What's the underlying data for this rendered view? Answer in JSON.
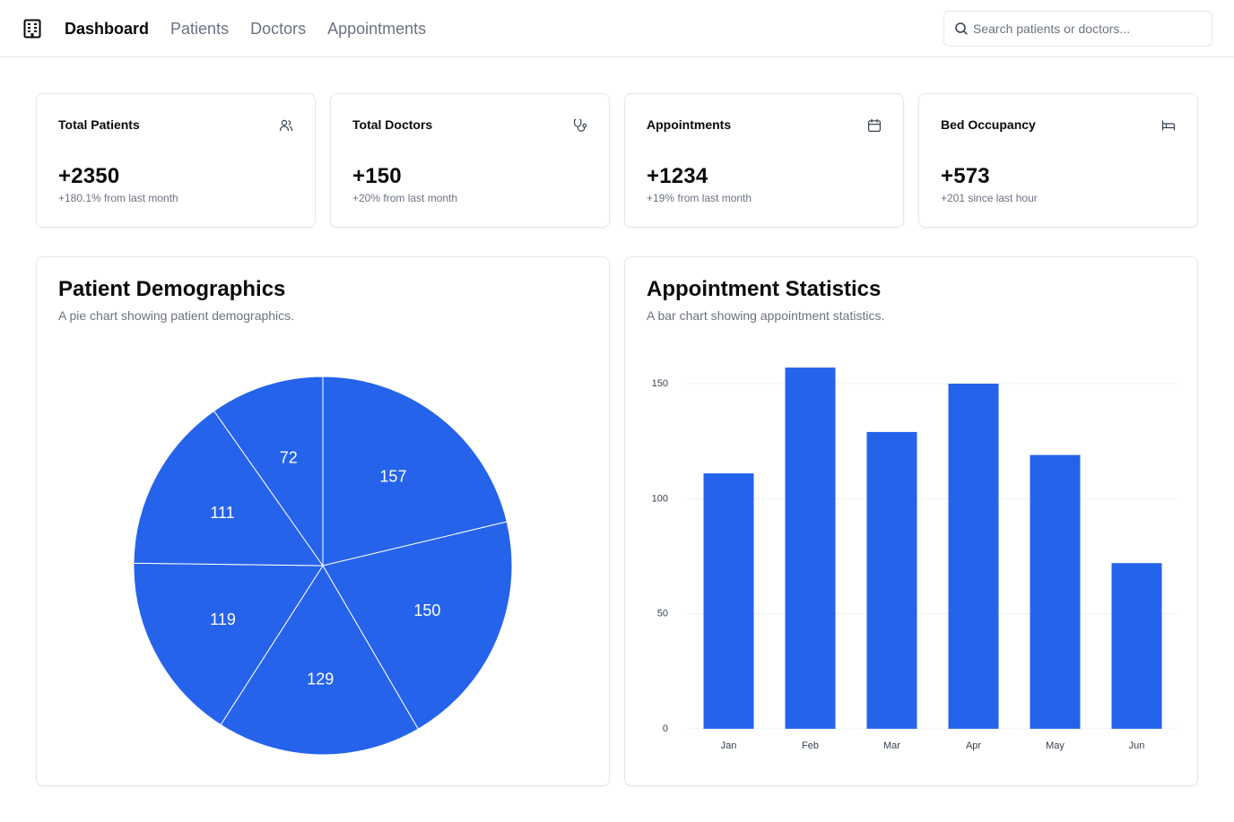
{
  "nav": {
    "items": [
      {
        "label": "Dashboard",
        "active": true
      },
      {
        "label": "Patients",
        "active": false
      },
      {
        "label": "Doctors",
        "active": false
      },
      {
        "label": "Appointments",
        "active": false
      }
    ]
  },
  "search": {
    "placeholder": "Search patients or doctors..."
  },
  "stats": [
    {
      "label": "Total Patients",
      "value": "+2350",
      "change": "+180.1% from last month",
      "icon": "users-icon"
    },
    {
      "label": "Total Doctors",
      "value": "+150",
      "change": "+20% from last month",
      "icon": "stethoscope-icon"
    },
    {
      "label": "Appointments",
      "value": "+1234",
      "change": "+19% from last month",
      "icon": "calendar-icon"
    },
    {
      "label": "Bed Occupancy",
      "value": "+573",
      "change": "+201 since last hour",
      "icon": "bed-icon"
    }
  ],
  "panels": {
    "demographics": {
      "title": "Patient Demographics",
      "description": "A pie chart showing patient demographics."
    },
    "appointments": {
      "title": "Appointment Statistics",
      "description": "A bar chart showing appointment statistics."
    }
  },
  "colors": {
    "accent": "#2563eb",
    "border": "#e5e7eb",
    "muted": "#6b7280"
  },
  "chart_data": [
    {
      "type": "pie",
      "title": "Patient Demographics",
      "values": [
        157,
        150,
        129,
        119,
        111,
        72
      ],
      "labels": [
        "157",
        "150",
        "129",
        "119",
        "111",
        "72"
      ],
      "color": "#2563eb"
    },
    {
      "type": "bar",
      "title": "Appointment Statistics",
      "categories": [
        "Jan",
        "Feb",
        "Mar",
        "Apr",
        "May",
        "Jun"
      ],
      "values": [
        111,
        157,
        129,
        150,
        119,
        72
      ],
      "ylim": [
        0,
        150
      ],
      "yticks": [
        0,
        50,
        100,
        150
      ],
      "grid": true,
      "color": "#2563eb"
    }
  ]
}
